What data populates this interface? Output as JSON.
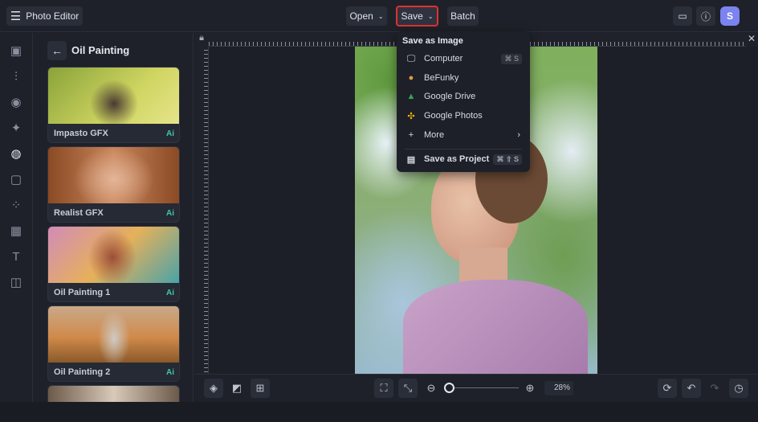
{
  "app": {
    "title": "Photo Editor",
    "menu_icon": "hamburger-icon"
  },
  "toolbar": {
    "open": "Open",
    "save": "Save",
    "batch": "Batch",
    "avatar_initial": "S",
    "accent": "#e0322c"
  },
  "panel": {
    "title": "Oil Painting",
    "items": [
      {
        "label": "Impasto GFX",
        "badge": "Ai"
      },
      {
        "label": "Realist GFX",
        "badge": "Ai"
      },
      {
        "label": "Oil Painting 1",
        "badge": "Ai"
      },
      {
        "label": "Oil Painting 2",
        "badge": "Ai"
      }
    ]
  },
  "save_menu": {
    "header": "Save as Image",
    "items": [
      {
        "label": "Computer",
        "shortcut": "⌘ S"
      },
      {
        "label": "BeFunky"
      },
      {
        "label": "Google Drive"
      },
      {
        "label": "Google Photos"
      },
      {
        "label": "More"
      }
    ],
    "project": {
      "label": "Save as Project",
      "shortcut": "⌘ ⇧ S"
    }
  },
  "zoom": {
    "value": "28%",
    "level": 0.05
  }
}
